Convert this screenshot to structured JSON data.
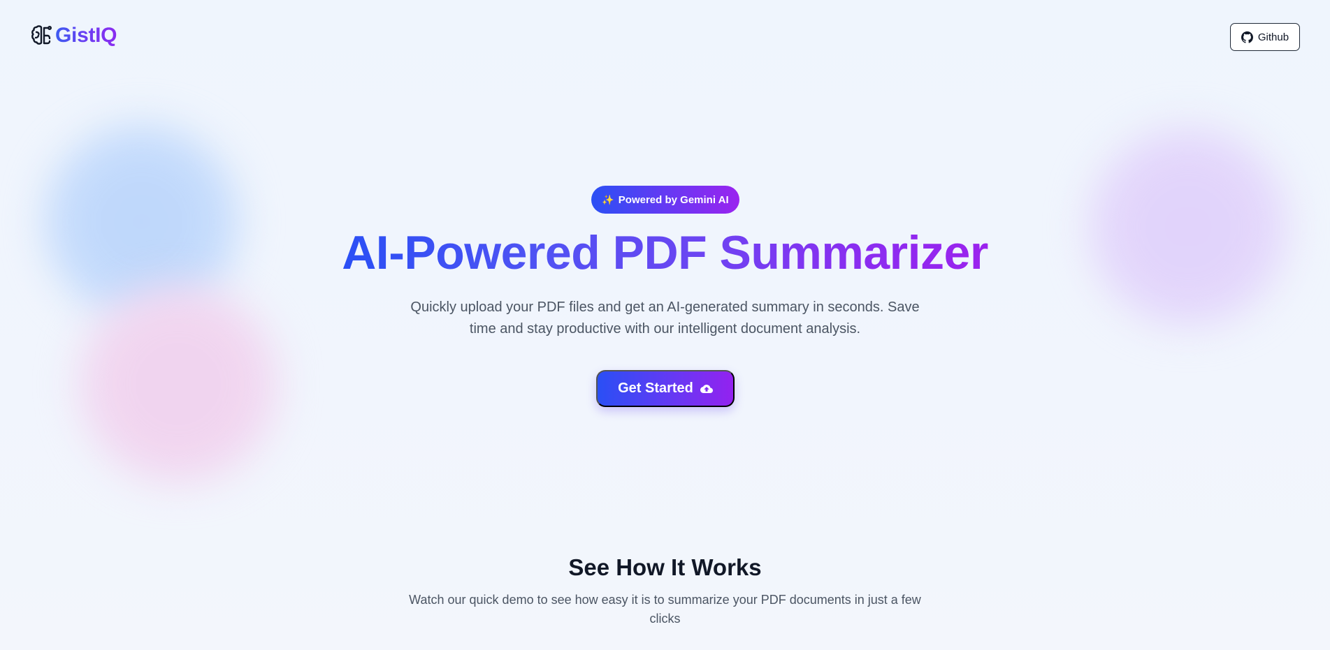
{
  "header": {
    "logo_text": "GistIQ",
    "logo_icon": "brain-icon",
    "github_label": "Github",
    "github_icon": "github-icon"
  },
  "hero": {
    "badge_sparkle": "✨",
    "badge_label": "Powered by Gemini AI",
    "title": "AI-Powered PDF Summarizer",
    "subtitle": "Quickly upload your PDF files and get an AI-generated summary in seconds. Save time and stay productive with our intelligent document analysis.",
    "cta_label": "Get Started",
    "cta_icon": "cloud-upload-icon"
  },
  "how_it_works": {
    "title": "See How It Works",
    "subtitle": "Watch our quick demo to see how easy it is to summarize your PDF documents in just a few clicks"
  },
  "colors": {
    "brand_blue": "#2a4ff5",
    "brand_purple": "#9322ef",
    "background": "#eff5fd",
    "text_muted": "#4b5563",
    "heading": "#111827"
  }
}
